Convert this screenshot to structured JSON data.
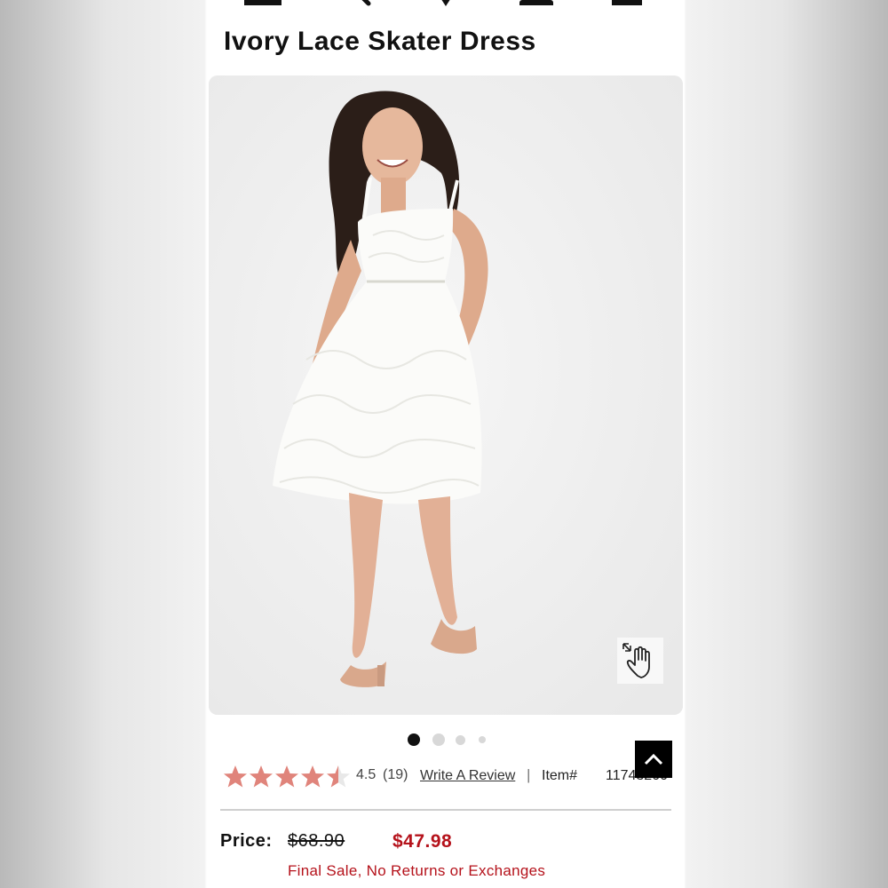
{
  "product": {
    "title": "Ivory Lace Skater Dress"
  },
  "nav_icons": [
    "menu-icon",
    "search-icon",
    "location-pin-icon",
    "account-icon",
    "shopping-bag-icon"
  ],
  "gallery": {
    "image_count": 4,
    "active_index": 0,
    "zoom_icon": "zoom-hand-icon"
  },
  "rating": {
    "value": "4.5",
    "count": "(19)",
    "stars": 4.5,
    "write_review": "Write A Review",
    "separator": "|",
    "item_label": "Item#",
    "item_number": "11743200"
  },
  "price": {
    "label": "Price:",
    "original": "$68.90",
    "sale": "$47.98",
    "note": "Final Sale, No Returns or Exchanges"
  },
  "colors": {
    "star": "#e0847b",
    "sale_red": "#b5121b",
    "text": "#111111",
    "image_bg": "#eeeeee"
  }
}
